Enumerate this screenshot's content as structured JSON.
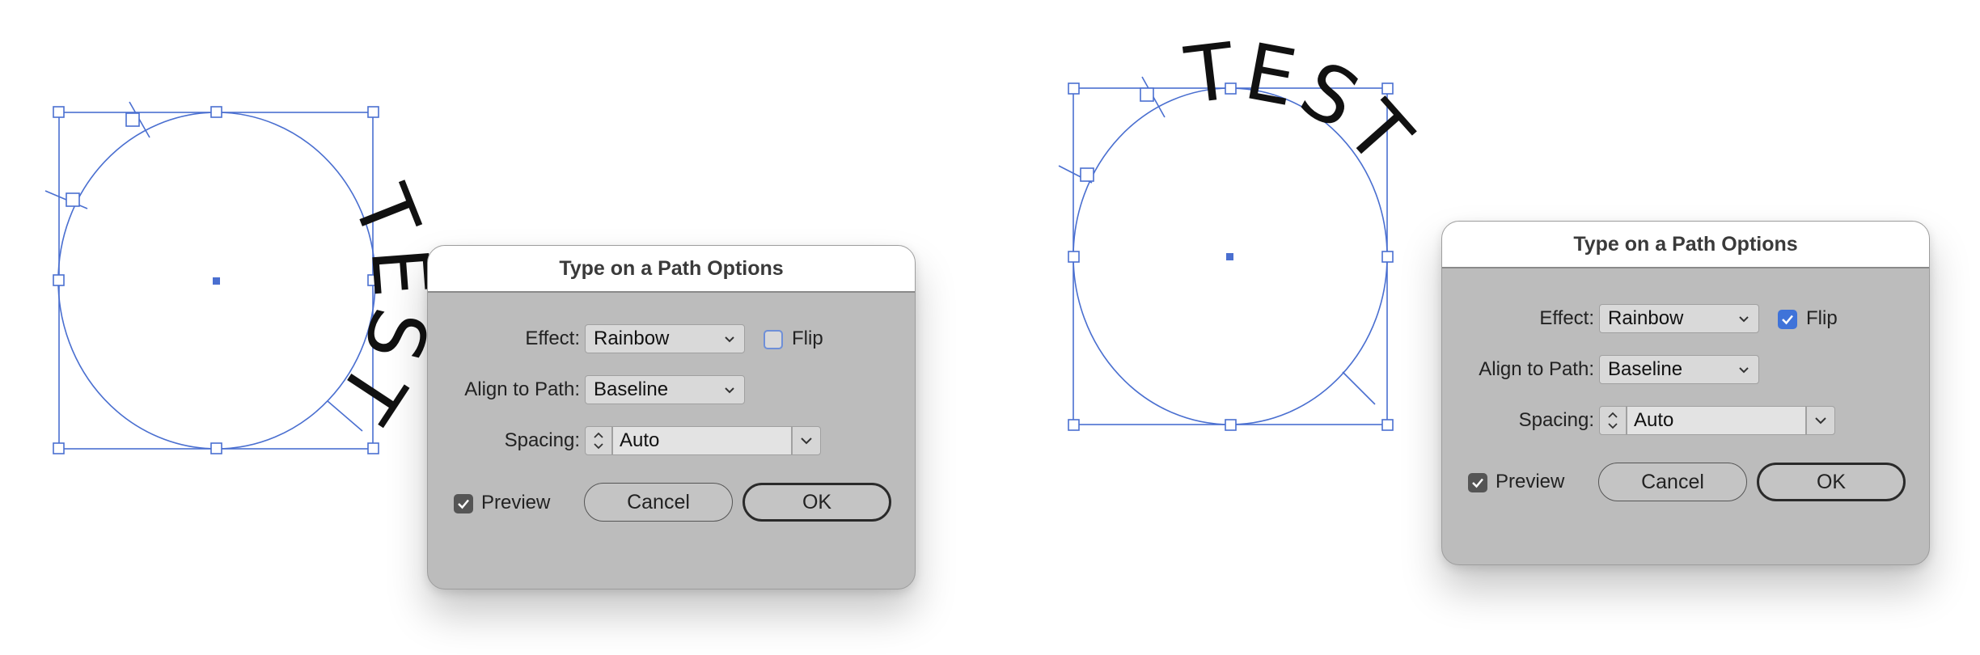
{
  "artwork": {
    "left": {
      "path_text": "TEST"
    },
    "right": {
      "path_text": "TEST"
    }
  },
  "colors": {
    "selection": "#4a6fd0",
    "dialog_bg": "#bcbcbc",
    "checkbox_blue": "#3f73d9"
  },
  "dialogs": [
    {
      "title": "Type on a Path Options",
      "effect_label": "Effect:",
      "effect_value": "Rainbow",
      "flip_label": "Flip",
      "flip_checked": false,
      "align_label": "Align to Path:",
      "align_value": "Baseline",
      "spacing_label": "Spacing:",
      "spacing_value": "Auto",
      "preview_label": "Preview",
      "preview_checked": true,
      "cancel_label": "Cancel",
      "ok_label": "OK"
    },
    {
      "title": "Type on a Path Options",
      "effect_label": "Effect:",
      "effect_value": "Rainbow",
      "flip_label": "Flip",
      "flip_checked": true,
      "align_label": "Align to Path:",
      "align_value": "Baseline",
      "spacing_label": "Spacing:",
      "spacing_value": "Auto",
      "preview_label": "Preview",
      "preview_checked": true,
      "cancel_label": "Cancel",
      "ok_label": "OK"
    }
  ]
}
